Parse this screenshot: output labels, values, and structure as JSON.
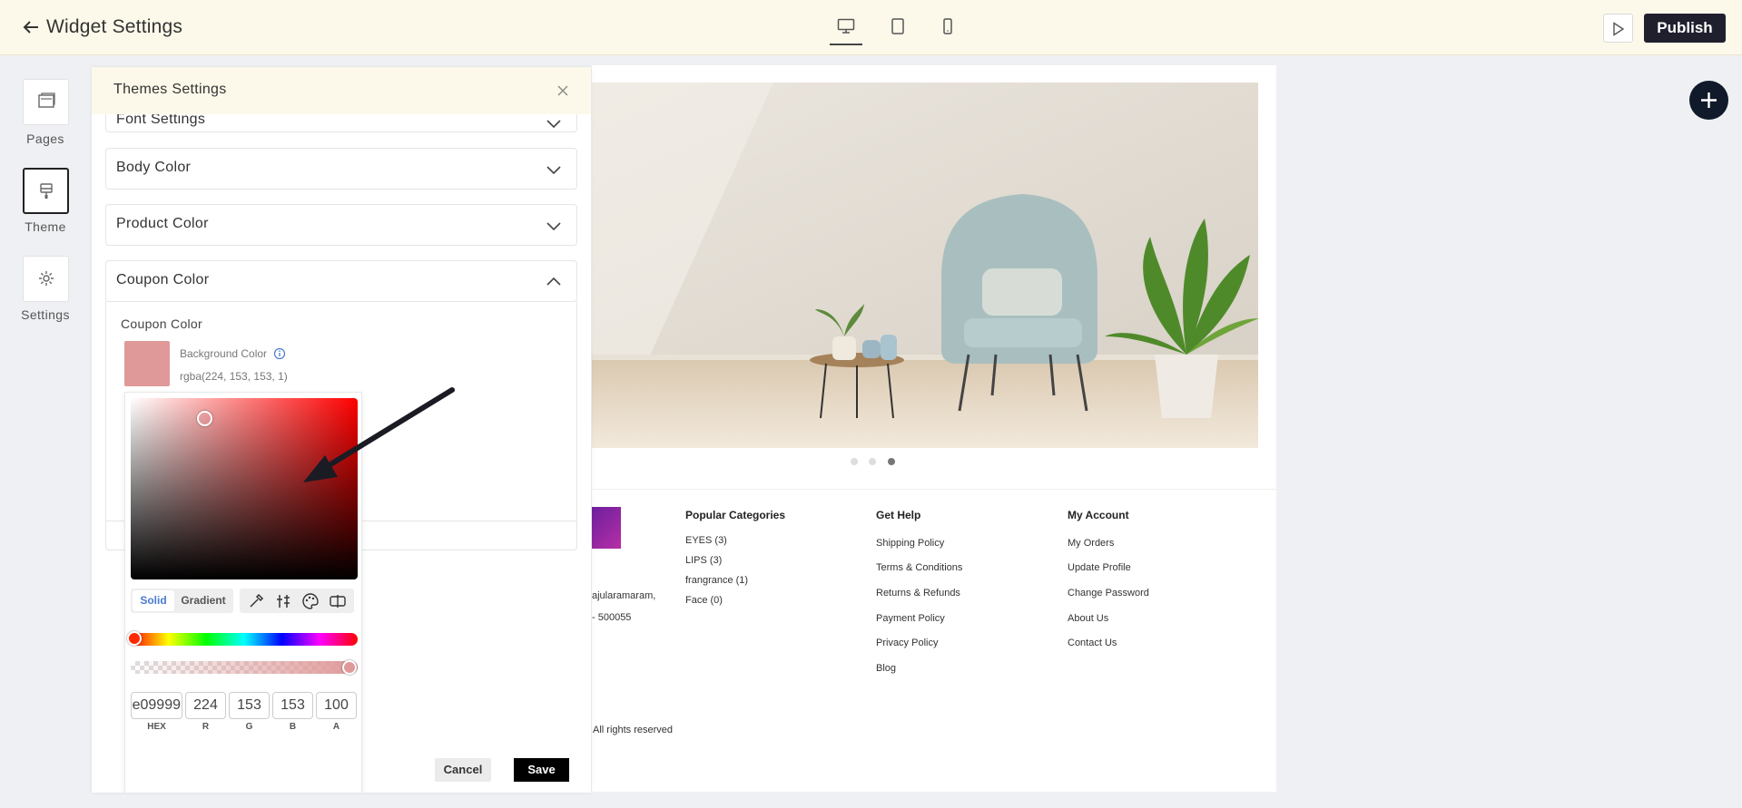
{
  "header": {
    "title": "Widget Settings",
    "devices": [
      {
        "name": "desktop",
        "active": true
      },
      {
        "name": "tablet",
        "active": false
      },
      {
        "name": "mobile",
        "active": false
      }
    ],
    "publish_label": "Publish"
  },
  "rail": {
    "items": [
      {
        "label": "Pages",
        "icon": "pages-icon"
      },
      {
        "label": "Theme",
        "icon": "theme-icon",
        "active": true
      },
      {
        "label": "Settings",
        "icon": "gear-icon"
      }
    ]
  },
  "panel": {
    "title": "Themes Settings",
    "sections": [
      {
        "label": "Font Settings",
        "expanded": false
      },
      {
        "label": "Body Color",
        "expanded": false
      },
      {
        "label": "Product Color",
        "expanded": false
      },
      {
        "label": "Coupon Color",
        "expanded": true
      }
    ],
    "coupon": {
      "heading": "Coupon Color",
      "background_label": "Background Color",
      "background_value": "rgba(224, 153, 153, 1)",
      "swatch_color": "#e09999"
    },
    "picker": {
      "mode_solid": "Solid",
      "mode_gradient": "Gradient",
      "hex": "e09999",
      "r": "224",
      "g": "153",
      "b": "153",
      "a": "100",
      "labels": {
        "hex": "HEX",
        "r": "R",
        "g": "G",
        "b": "B",
        "a": "A"
      }
    },
    "cancel_label": "Cancel",
    "save_label": "Save"
  },
  "footer": {
    "address_line1": "ajularamaram,",
    "address_line2": "- 500055",
    "copyright": "All rights reserved",
    "columns": [
      {
        "heading": "Popular Categories",
        "links": [
          "EYES (3)",
          "LIPS (3)",
          "frangrance (1)",
          "Face (0)"
        ]
      },
      {
        "heading": "Get Help",
        "links": [
          "Shipping Policy",
          "Terms & Conditions",
          "Returns & Refunds",
          "Payment Policy",
          "Privacy Policy",
          "Blog"
        ]
      },
      {
        "heading": "My Account",
        "links": [
          "My Orders",
          "Update Profile",
          "Change Password",
          "About Us",
          "Contact Us"
        ]
      }
    ]
  },
  "colors": {
    "accent": "#1f1f2e",
    "header_bg": "#fdf9ea",
    "swatch": "#e09999"
  }
}
